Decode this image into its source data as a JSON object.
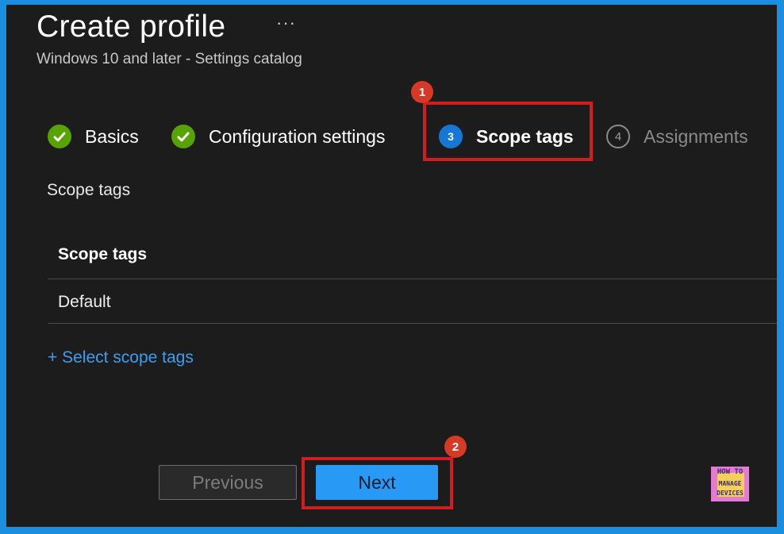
{
  "header": {
    "title": "Create profile",
    "more_label": "···",
    "subtitle": "Windows 10 and later - Settings catalog"
  },
  "steps": [
    {
      "label": "Basics",
      "state": "complete",
      "icon": "check-icon"
    },
    {
      "label": "Configuration settings",
      "state": "complete",
      "icon": "check-icon"
    },
    {
      "label": "Scope tags",
      "state": "current",
      "number": "3"
    },
    {
      "label": "Assignments",
      "state": "future",
      "number": "4"
    }
  ],
  "annotations": {
    "badge_1": "1",
    "badge_2": "2"
  },
  "scope_section": {
    "label": "Scope tags",
    "table_header": "Scope tags",
    "rows": [
      "Default"
    ],
    "select_link": "+ Select scope tags"
  },
  "footer": {
    "previous_label": "Previous",
    "next_label": "Next"
  },
  "logo": {
    "line1": "HOW TO",
    "line2": "MANAGE",
    "line3": "DEVICES"
  },
  "colors": {
    "background": "#1c1c1c",
    "frame_border": "#1a8fe0",
    "accent_blue": "#2899f5",
    "link_blue": "#3b9ff0",
    "success_green": "#57a300",
    "highlight_red": "#d11d1d"
  }
}
